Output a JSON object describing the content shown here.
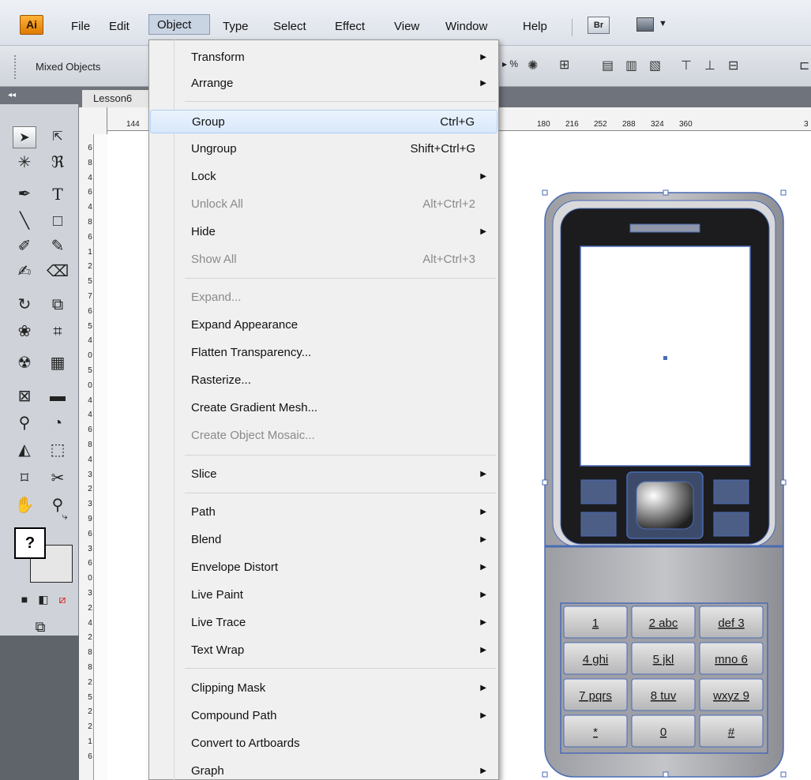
{
  "app": {
    "logo": "Ai"
  },
  "menubar": {
    "items": [
      "File",
      "Edit",
      "Object",
      "Type",
      "Select",
      "Effect",
      "View",
      "Window",
      "Help"
    ],
    "bridge_label": "Br"
  },
  "controlbar": {
    "selection_label": "Mixed Objects",
    "pct_label": "%"
  },
  "tools_panel": {
    "collapse_label": "◂◂",
    "fill_stroke_label": "?"
  },
  "document": {
    "tab_title": "Lesson6"
  },
  "ruler": {
    "horizontal_ticks": [
      "144",
      "180",
      "216",
      "252",
      "288",
      "324",
      "360",
      "3"
    ],
    "vertical_digits": [
      "6",
      "8",
      "4",
      "6",
      "4",
      "8",
      "6",
      "1",
      "2",
      "5",
      "7",
      "6",
      "5",
      "4",
      "0",
      "5",
      "0",
      "4",
      "4",
      "6",
      "8",
      "4",
      "3",
      "2",
      "3",
      "9",
      "6",
      "3",
      "6",
      "0",
      "3",
      "2",
      "4",
      "2",
      "8",
      "8",
      "2",
      "5",
      "2",
      "2",
      "1",
      "6"
    ]
  },
  "object_menu": {
    "items": [
      {
        "label": "Transform",
        "shortcut": "",
        "submenu": true,
        "disabled": false
      },
      {
        "label": "Arrange",
        "shortcut": "",
        "submenu": true,
        "disabled": false
      },
      {
        "label": "Group",
        "shortcut": "Ctrl+G",
        "submenu": false,
        "disabled": false,
        "highlighted": true
      },
      {
        "label": "Ungroup",
        "shortcut": "Shift+Ctrl+G",
        "submenu": false,
        "disabled": false
      },
      {
        "label": "Lock",
        "shortcut": "",
        "submenu": true,
        "disabled": false
      },
      {
        "label": "Unlock All",
        "shortcut": "Alt+Ctrl+2",
        "submenu": false,
        "disabled": true
      },
      {
        "label": "Hide",
        "shortcut": "",
        "submenu": true,
        "disabled": false
      },
      {
        "label": "Show All",
        "shortcut": "Alt+Ctrl+3",
        "submenu": false,
        "disabled": true
      },
      {
        "label": "Expand...",
        "shortcut": "",
        "submenu": false,
        "disabled": true
      },
      {
        "label": "Expand Appearance",
        "shortcut": "",
        "submenu": false,
        "disabled": false
      },
      {
        "label": "Flatten Transparency...",
        "shortcut": "",
        "submenu": false,
        "disabled": false
      },
      {
        "label": "Rasterize...",
        "shortcut": "",
        "submenu": false,
        "disabled": false
      },
      {
        "label": "Create Gradient Mesh...",
        "shortcut": "",
        "submenu": false,
        "disabled": false
      },
      {
        "label": "Create Object Mosaic...",
        "shortcut": "",
        "submenu": false,
        "disabled": true
      },
      {
        "label": "Slice",
        "shortcut": "",
        "submenu": true,
        "disabled": false
      },
      {
        "label": "Path",
        "shortcut": "",
        "submenu": true,
        "disabled": false
      },
      {
        "label": "Blend",
        "shortcut": "",
        "submenu": true,
        "disabled": false
      },
      {
        "label": "Envelope Distort",
        "shortcut": "",
        "submenu": true,
        "disabled": false
      },
      {
        "label": "Live Paint",
        "shortcut": "",
        "submenu": true,
        "disabled": false
      },
      {
        "label": "Live Trace",
        "shortcut": "",
        "submenu": true,
        "disabled": false
      },
      {
        "label": "Text Wrap",
        "shortcut": "",
        "submenu": true,
        "disabled": false
      },
      {
        "label": "Clipping Mask",
        "shortcut": "",
        "submenu": true,
        "disabled": false
      },
      {
        "label": "Compound Path",
        "shortcut": "",
        "submenu": true,
        "disabled": false
      },
      {
        "label": "Convert to Artboards",
        "shortcut": "",
        "submenu": false,
        "disabled": false
      },
      {
        "label": "Graph",
        "shortcut": "",
        "submenu": true,
        "disabled": false
      }
    ]
  },
  "phone": {
    "keypad": [
      "1",
      "2 abc",
      "def 3",
      "4 ghi",
      "5 jkl",
      "mno 6",
      "7 pqrs",
      "8 tuv",
      "wxyz 9",
      "*",
      "0",
      "#"
    ]
  },
  "colors": {
    "selection": "#4a6bb5",
    "menu_highlight": "#d9e8fa",
    "app_logo": "#f39a1d"
  }
}
